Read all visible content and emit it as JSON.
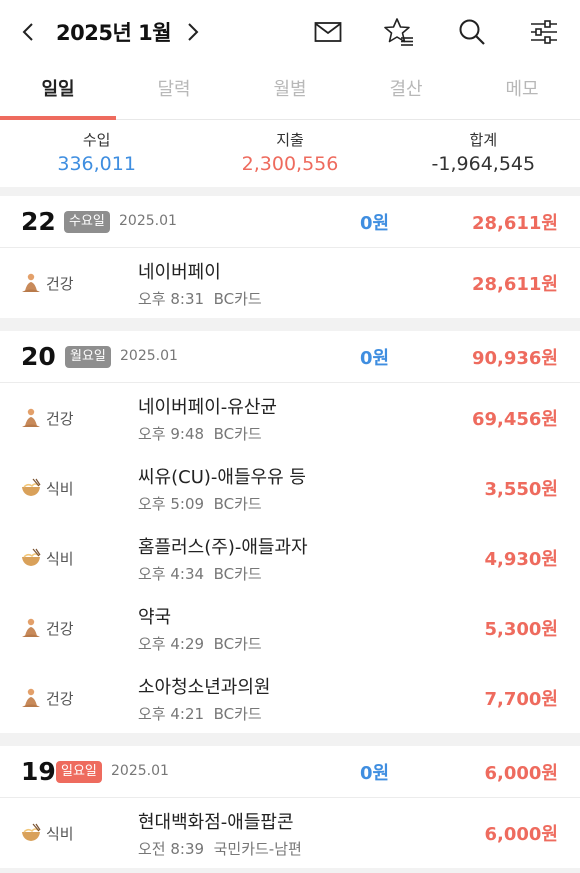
{
  "header": {
    "title": "2025년 1월",
    "prev_icon": "chevron-left-icon",
    "next_icon": "chevron-right-icon",
    "icons": [
      "mail-icon",
      "star-list-icon",
      "search-icon",
      "filter-sliders-icon"
    ]
  },
  "tabs": [
    {
      "label": "일일",
      "active": true
    },
    {
      "label": "달력",
      "active": false
    },
    {
      "label": "월별",
      "active": false
    },
    {
      "label": "결산",
      "active": false
    },
    {
      "label": "메모",
      "active": false
    }
  ],
  "summary": {
    "income_label": "수입",
    "income_value": "336,011",
    "expense_label": "지출",
    "expense_value": "2,300,556",
    "total_label": "합계",
    "total_value": "-1,964,545"
  },
  "colors": {
    "accent": "#ee6b5e",
    "income": "#3f8ee0",
    "expense": "#ee6b5e",
    "total": "#333333"
  },
  "days": [
    {
      "day": "22",
      "weekday": "수요일",
      "badge_color": "#8e8e8e",
      "date": "2025.01",
      "income": "0원",
      "expense": "28,611원",
      "entries": [
        {
          "category": "건강",
          "icon": "meditation-person-icon",
          "title": "네이버페이",
          "time": "오후 8:31",
          "payment": "BC카드",
          "amount": "28,611원"
        }
      ]
    },
    {
      "day": "20",
      "weekday": "월요일",
      "badge_color": "#8e8e8e",
      "date": "2025.01",
      "income": "0원",
      "expense": "90,936원",
      "entries": [
        {
          "category": "건강",
          "icon": "meditation-person-icon",
          "title": "네이버페이-유산균",
          "time": "오후 9:48",
          "payment": "BC카드",
          "amount": "69,456원"
        },
        {
          "category": "식비",
          "icon": "noodle-bowl-icon",
          "title": "씨유(CU)-애들우유 등",
          "time": "오후 5:09",
          "payment": "BC카드",
          "amount": "3,550원"
        },
        {
          "category": "식비",
          "icon": "noodle-bowl-icon",
          "title": "홈플러스(주)-애들과자",
          "time": "오후 4:34",
          "payment": "BC카드",
          "amount": "4,930원"
        },
        {
          "category": "건강",
          "icon": "meditation-person-icon",
          "title": "약국",
          "time": "오후 4:29",
          "payment": "BC카드",
          "amount": "5,300원"
        },
        {
          "category": "건강",
          "icon": "meditation-person-icon",
          "title": "소아청소년과의원",
          "time": "오후 4:21",
          "payment": "BC카드",
          "amount": "7,700원"
        }
      ]
    },
    {
      "day": "19",
      "weekday": "일요일",
      "badge_color": "#ee6b5e",
      "date": "2025.01",
      "income": "0원",
      "expense": "6,000원",
      "entries": [
        {
          "category": "식비",
          "icon": "noodle-bowl-icon",
          "title": "현대백화점-애들팝콘",
          "time": "오전 8:39",
          "payment": "국민카드-남편",
          "amount": "6,000원"
        }
      ]
    }
  ]
}
